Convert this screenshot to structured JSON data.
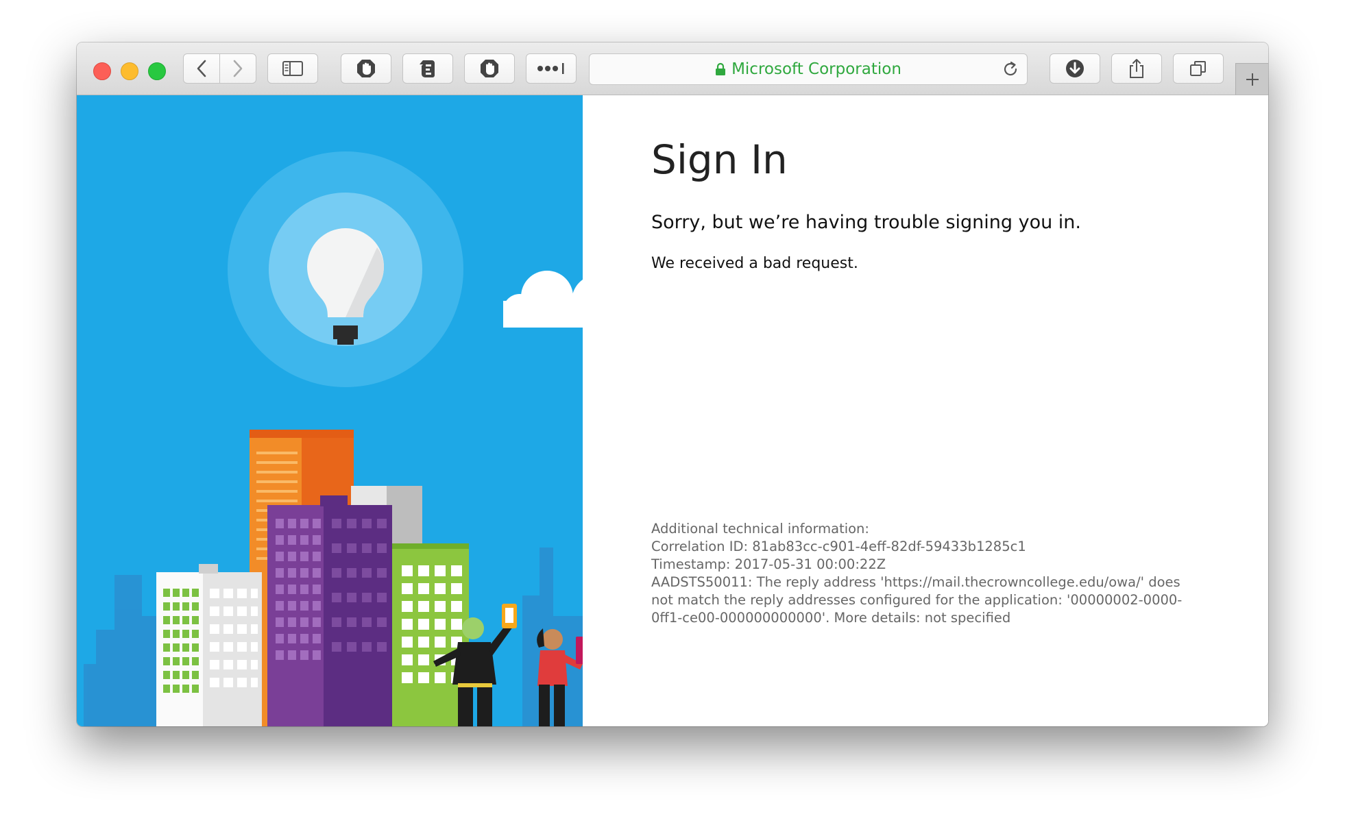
{
  "browser": {
    "address_title": "Microsoft Corporation",
    "security": "lock-icon",
    "accent_color": "#2fa83e",
    "toolbar_icons": [
      "back-icon",
      "forward-icon",
      "sidebar-icon",
      "extension-hand-icon",
      "extension-evernote-icon",
      "extension-stop-icon",
      "extension-password-icon",
      "reload-icon",
      "download-icon",
      "share-icon",
      "tabs-icon",
      "plus-icon"
    ]
  },
  "page": {
    "title": "Sign In",
    "subtitle": "Sorry, but we’re having trouble signing you in.",
    "message": "We received a bad request.",
    "illustration_color": "#1ea8e6"
  },
  "tech_info": {
    "heading": "Additional technical information:",
    "correlation": "Correlation ID: 81ab83cc-c901-4eff-82df-59433b1285c1",
    "timestamp": "Timestamp: 2017-05-31 00:00:22Z",
    "error_line1": "AADSTS50011: The reply address 'https://mail.thecrowncollege.edu/owa/' does",
    "error_line2": "not match the reply addresses configured for the application: '00000002-0000-",
    "error_line3": "0ff1-ce00-000000000000'. More details: not specified"
  }
}
